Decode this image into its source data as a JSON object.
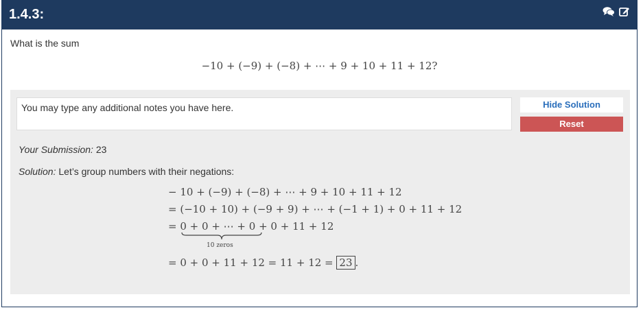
{
  "header": {
    "title": "1.4.3:"
  },
  "question": {
    "prompt": "What is the sum",
    "math": "−10 + (−9) + (−8) + ⋯ + 9 + 10 + 11 + 12?"
  },
  "notes": {
    "placeholder": "You may type any additional notes you have here."
  },
  "buttons": {
    "hide_solution": "Hide Solution",
    "reset": "Reset"
  },
  "submission": {
    "label": "Your Submission:",
    "value": "23"
  },
  "solution": {
    "label": "Solution:",
    "text": "Let’s group numbers with their negations:",
    "lines": {
      "line1": "− 10 + (−9) + (−8) + ⋯ + 9 + 10 + 11 + 12",
      "line2": "= (−10 + 10) + (−9 + 9) + ⋯ + (−1 + 1) + 0 + 11 + 12",
      "line3_prefix": "=",
      "line3_brace": "0 + 0 + ⋯ + 0",
      "line3_suffix": "+ 0 + 11 + 12",
      "brace_label": "10 zeros",
      "line4_prefix": "= 0 + 0 + 11 + 12 = 11 + 12 =",
      "line4_answer": "23",
      "line4_end": "."
    }
  },
  "icons": {
    "comments": "comments-icon",
    "edit": "edit-icon"
  },
  "colors": {
    "header_bg": "#1e3a5f",
    "reset_bg": "#cc5555",
    "link_blue": "#2a6ebb",
    "panel_bg": "#ededed"
  }
}
